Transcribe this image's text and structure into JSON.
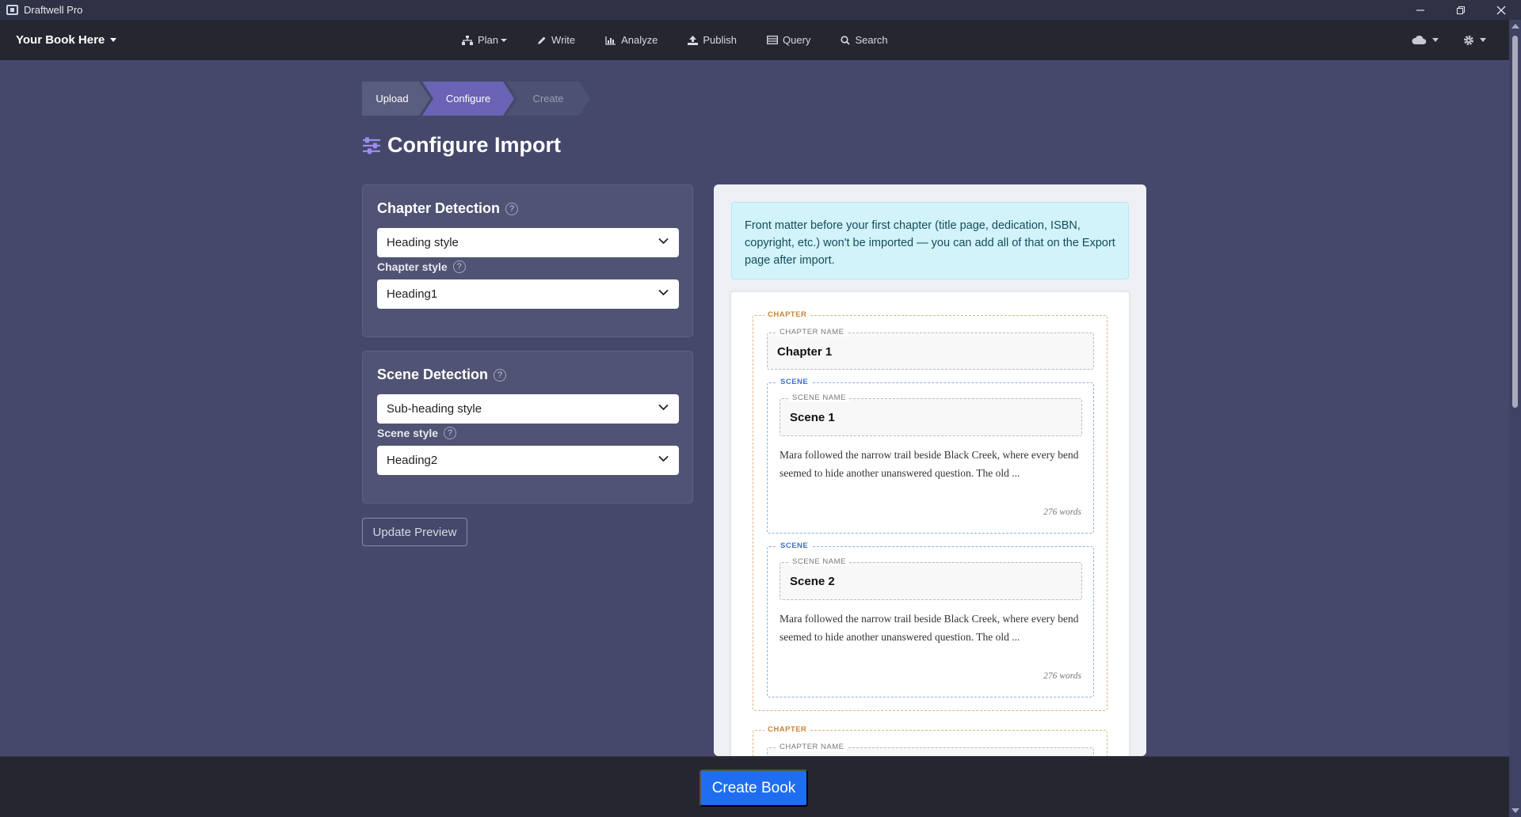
{
  "window": {
    "title": "Draftwell Pro"
  },
  "nav": {
    "book_title": "Your Book Here",
    "items": [
      {
        "label": "Plan",
        "icon": "sitemap-icon",
        "dropdown": true
      },
      {
        "label": "Write",
        "icon": "pencil-icon"
      },
      {
        "label": "Analyze",
        "icon": "bar-chart-icon"
      },
      {
        "label": "Publish",
        "icon": "upload-icon"
      },
      {
        "label": "Query",
        "icon": "table-icon"
      },
      {
        "label": "Search",
        "icon": "search-icon"
      }
    ],
    "right_icons": [
      "cloud-icon",
      "gear-icon"
    ]
  },
  "stepper": {
    "steps": [
      {
        "label": "Upload",
        "state": "done"
      },
      {
        "label": "Configure",
        "state": "active"
      },
      {
        "label": "Create",
        "state": "pending"
      }
    ]
  },
  "page": {
    "title": "Configure Import",
    "title_icon": "sliders-icon"
  },
  "chapter_detection": {
    "title": "Chapter Detection",
    "method": "Heading style",
    "style_label": "Chapter style",
    "style_value": "Heading1"
  },
  "scene_detection": {
    "title": "Scene Detection",
    "method": "Sub-heading style",
    "style_label": "Scene style",
    "style_value": "Heading2"
  },
  "update_preview_label": "Update Preview",
  "preview": {
    "notice": "Front matter before your first chapter (title page, dedication, ISBN, copyright, etc.) won't be imported — you can add all of that on the Export page after import.",
    "chapter_legend": "CHAPTER",
    "chapter_name_legend": "CHAPTER NAME",
    "scene_legend": "SCENE",
    "scene_name_legend": "SCENE NAME",
    "chapters": [
      {
        "name": "Chapter 1",
        "scenes": [
          {
            "name": "Scene 1",
            "excerpt": "Mara followed the narrow trail beside Black Creek, where every bend seemed to hide another unanswered question. The old ...",
            "words": "276 words"
          },
          {
            "name": "Scene 2",
            "excerpt": "Mara followed the narrow trail beside Black Creek, where every bend seemed to hide another unanswered question. The old ...",
            "words": "276 words"
          }
        ]
      }
    ]
  },
  "footer": {
    "create_label": "Create Book"
  },
  "colors": {
    "accent": "#6b63b5",
    "primary_button": "#1f6ef2",
    "background": "#45486a"
  }
}
